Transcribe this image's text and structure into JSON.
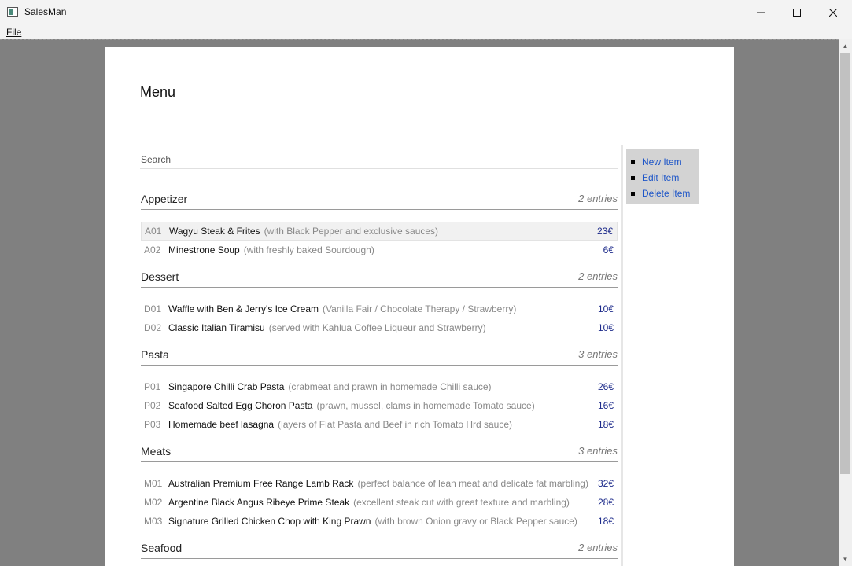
{
  "window": {
    "title": "SalesMan"
  },
  "menubar": {
    "file": "File"
  },
  "page": {
    "title": "Menu",
    "search_placeholder": "Search",
    "actions": [
      {
        "label": "New Item"
      },
      {
        "label": "Edit Item"
      },
      {
        "label": "Delete Item"
      }
    ],
    "categories": [
      {
        "name": "Appetizer",
        "count": "2 entries",
        "items": [
          {
            "code": "A01",
            "name": "Wagyu Steak & Frites",
            "desc": "(with Black Pepper and exclusive sauces)",
            "price": "23€"
          },
          {
            "code": "A02",
            "name": "Minestrone Soup",
            "desc": "(with freshly baked Sourdough)",
            "price": "6€"
          }
        ]
      },
      {
        "name": "Dessert",
        "count": "2 entries",
        "items": [
          {
            "code": "D01",
            "name": "Waffle with Ben & Jerry's Ice Cream",
            "desc": "(Vanilla Fair / Chocolate Therapy / Strawberry)",
            "price": "10€"
          },
          {
            "code": "D02",
            "name": "Classic Italian Tiramisu",
            "desc": "(served with Kahlua Coffee Liqueur and Strawberry)",
            "price": "10€"
          }
        ]
      },
      {
        "name": "Pasta",
        "count": "3 entries",
        "items": [
          {
            "code": "P01",
            "name": "Singapore Chilli Crab Pasta",
            "desc": "(crabmeat and prawn in homemade Chilli sauce)",
            "price": "26€"
          },
          {
            "code": "P02",
            "name": "Seafood Salted Egg Choron Pasta",
            "desc": "(prawn, mussel, clams in homemade Tomato sauce)",
            "price": "16€"
          },
          {
            "code": "P03",
            "name": "Homemade beef lasagna",
            "desc": "(layers of Flat Pasta and Beef in rich Tomato Hrd sauce)",
            "price": "18€"
          }
        ]
      },
      {
        "name": "Meats",
        "count": "3 entries",
        "items": [
          {
            "code": "M01",
            "name": "Australian Premium Free Range Lamb Rack",
            "desc": "(perfect balance of lean meat and delicate fat marbling)",
            "price": "32€"
          },
          {
            "code": "M02",
            "name": "Argentine Black Angus Ribeye Prime Steak",
            "desc": "(excellent steak cut with great texture and marbling)",
            "price": "28€"
          },
          {
            "code": "M03",
            "name": "Signature Grilled Chicken Chop with King Prawn",
            "desc": "(with brown Onion gravy or Black Pepper sauce)",
            "price": "18€"
          }
        ]
      },
      {
        "name": "Seafood",
        "count": "2 entries",
        "items": []
      }
    ]
  }
}
